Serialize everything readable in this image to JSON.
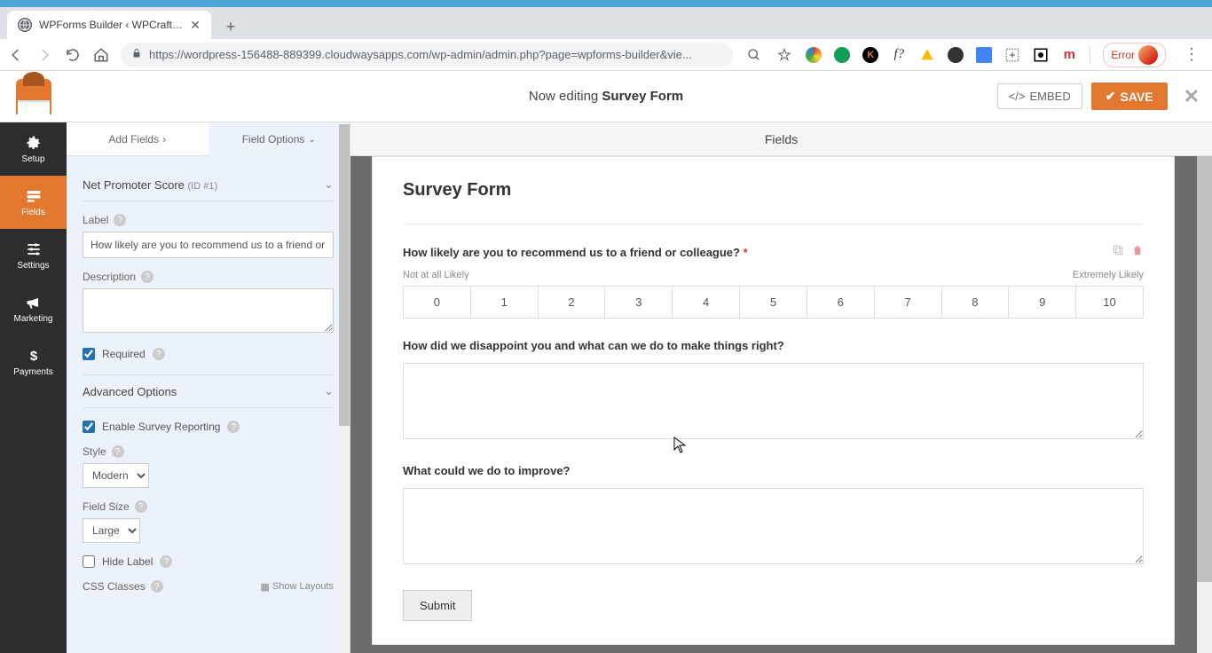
{
  "browser": {
    "tab_title": "WPForms Builder ‹ WPCrafter —",
    "url": "https://wordpress-156488-889399.cloudwaysapps.com/wp-admin/admin.php?page=wpforms-builder&vie...",
    "error_label": "Error"
  },
  "header": {
    "prefix": "Now editing ",
    "title_bold": "Survey Form",
    "embed_label": "EMBED",
    "save_label": "SAVE"
  },
  "sidenav": {
    "setup": "Setup",
    "fields": "Fields",
    "settings": "Settings",
    "marketing": "Marketing",
    "payments": "Payments"
  },
  "panel": {
    "tab_add_fields": "Add Fields",
    "tab_field_options": "Field Options",
    "section1_title": "Net Promoter Score",
    "section1_id": "(ID #1)",
    "label_label": "Label",
    "label_value": "How likely are you to recommend us to a friend or colleague?",
    "description_label": "Description",
    "required_label": "Required",
    "section2_title": "Advanced Options",
    "enable_survey_label": "Enable Survey Reporting",
    "style_label": "Style",
    "style_value": "Modern",
    "size_label": "Field Size",
    "size_value": "Large",
    "hide_label": "Hide Label",
    "css_classes_label": "CSS Classes",
    "show_layouts": "Show Layouts"
  },
  "preview": {
    "fields_tab": "Fields",
    "form_title": "Survey Form",
    "nps_label": "How likely are you to recommend us to a friend or colleague?",
    "nps_low": "Not at all Likely",
    "nps_high": "Extremely Likely",
    "nps_values": [
      "0",
      "1",
      "2",
      "3",
      "4",
      "5",
      "6",
      "7",
      "8",
      "9",
      "10"
    ],
    "q2_label": "How did we disappoint you and what can we do to make things right?",
    "q3_label": "What could we do to improve?",
    "submit_label": "Submit"
  }
}
